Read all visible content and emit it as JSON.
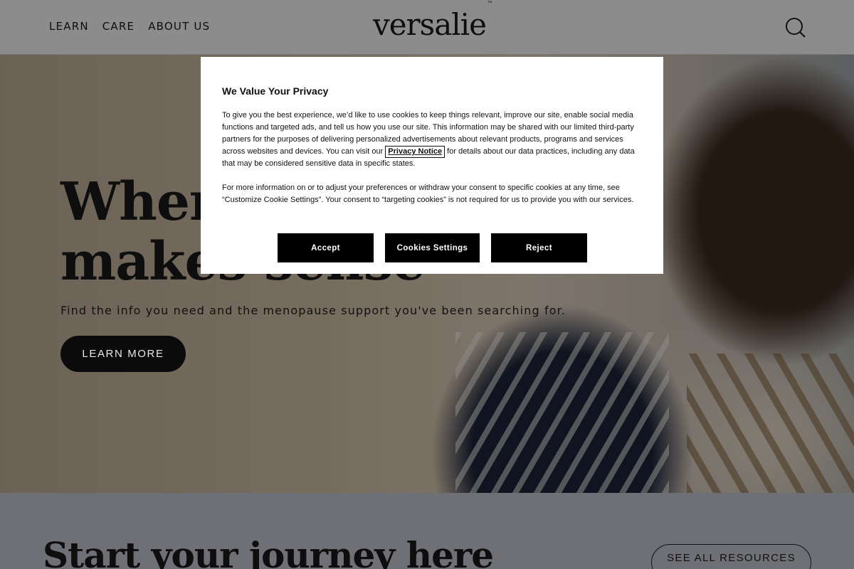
{
  "header": {
    "nav": [
      {
        "label": "LEARN"
      },
      {
        "label": "CARE"
      },
      {
        "label": "ABOUT US"
      }
    ],
    "logo_text": "versalie",
    "logo_mark": "™",
    "search_icon": "search-icon"
  },
  "hero": {
    "title_line1": "Where",
    "title_line2": "makes sense",
    "subtitle": "Find the info you need and the menopause support you've been searching for.",
    "cta_label": "LEARN MORE"
  },
  "resources": {
    "title": "Start your journey here",
    "cta_label": "SEE ALL RESOURCES"
  },
  "cookie_modal": {
    "title": "We Value Your Privacy",
    "para1_before": "To give you the best experience, we’d like to use cookies to keep things relevant, improve our site, enable social media functions and targeted ads, and tell us how you use our site. This information may be shared with our limited third-party partners for the purposes of delivering personalized advertisements about relevant products, programs and services across websites and devices. You can visit our ",
    "privacy_link": "Privacy Notice",
    "para1_after": " for details about our data practices, including any data that may be considered sensitive data in specific states.",
    "para2": "For more information on or to adjust your preferences or withdraw your consent to specific cookies at any time, see “Customize Cookie Settings”. Your consent to “targeting cookies” is not required for us to provide you with our services.",
    "buttons": {
      "accept": "Accept",
      "settings": "Cookies Settings",
      "reject": "Reject"
    }
  },
  "colors": {
    "button_dark": "#000000",
    "overlay": "rgba(0,0,0,0.45)"
  }
}
